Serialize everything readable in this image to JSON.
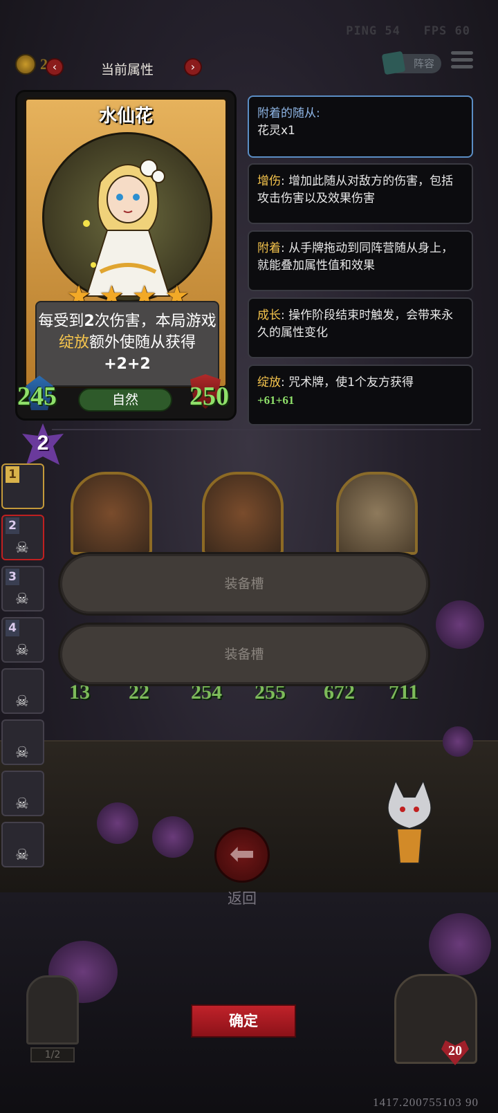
{
  "top_bar": {
    "ping": "PING 54",
    "fps": "FPS 60",
    "coin_count": "21",
    "prev_label": "‹",
    "next_label": "›",
    "title": "当前属性",
    "lineup_label": "阵容"
  },
  "card": {
    "name": "水仙花",
    "stars": 4,
    "desc_parts": [
      "每受到",
      "2",
      "次伤害，本局游戏",
      "绽放",
      "额外使随从获得",
      "+2+2"
    ],
    "attack": "245",
    "health": "250",
    "tribe": "自然",
    "tier": "2"
  },
  "panels": [
    {
      "key": "附着的随从:",
      "text": "花灵x1"
    },
    {
      "key": "增伤",
      "text": ": 增加此随从对敌方的伤害，包括攻击伤害以及效果伤害"
    },
    {
      "key": "附着",
      "text": ": 从手牌拖动到同阵营随从身上，就能叠加属性值和效果"
    },
    {
      "key": "成长",
      "text": ": 操作阶段结束时触发，会带来永久的属性变化"
    },
    {
      "key": "绽放",
      "text": ": 咒术牌，使1个友方获得",
      "extra": "+61+61"
    }
  ],
  "side_list": [
    {
      "index": "1"
    },
    {
      "index": "2"
    },
    {
      "index": "3"
    },
    {
      "index": "4"
    }
  ],
  "minions": [
    {
      "atk": "13",
      "hp": "22"
    },
    {
      "atk": "254",
      "hp": "255"
    },
    {
      "atk": "672",
      "hp": "711"
    }
  ],
  "equip_slots": [
    "装备槽",
    "装备槽"
  ],
  "back_label": "返回",
  "confirm_label": "确定",
  "page_indicator": "1/2",
  "hero_health": "20",
  "coord": "1417.200755103 90"
}
